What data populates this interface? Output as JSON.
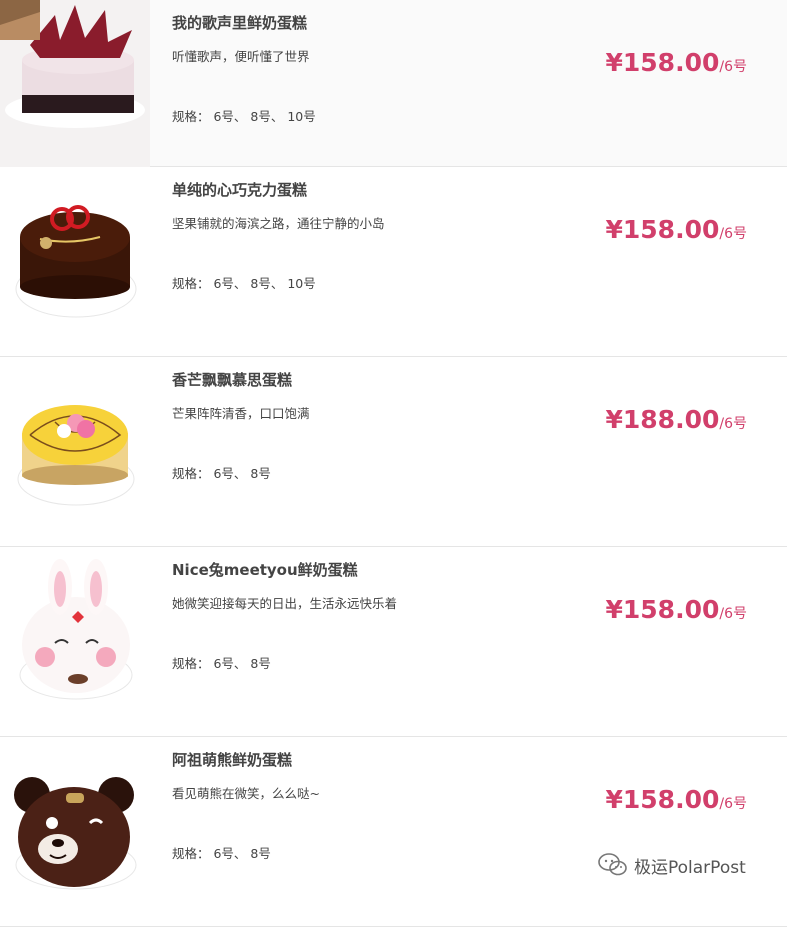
{
  "products": [
    {
      "name": "我的歌声里鲜奶蛋糕",
      "desc": "听懂歌声，便听懂了世界",
      "spec": "规格： 6号、 8号、 10号",
      "price": "¥158.00",
      "unit": "/6号",
      "image": "cake-red-leaves"
    },
    {
      "name": "单纯的心巧克力蛋糕",
      "desc": "坚果铺就的海滨之路，通往宁静的小岛",
      "spec": "规格： 6号、 8号、 10号",
      "price": "¥158.00",
      "unit": "/6号",
      "image": "cake-chocolate-heart"
    },
    {
      "name": "香芒飘飘慕思蛋糕",
      "desc": "芒果阵阵清香，口口饱满",
      "spec": "规格： 6号、 8号",
      "price": "¥188.00",
      "unit": "/6号",
      "image": "cake-mango-mousse"
    },
    {
      "name": "Nice兔meetyou鲜奶蛋糕",
      "desc": "她微笑迎接每天的日出，生活永远快乐着",
      "spec": "规格： 6号、 8号",
      "price": "¥158.00",
      "unit": "/6号",
      "image": "cake-bunny"
    },
    {
      "name": "阿祖萌熊鲜奶蛋糕",
      "desc": "看见萌熊在微笑，么么哒~",
      "spec": "规格： 6号、 8号",
      "price": "¥158.00",
      "unit": "/6号",
      "image": "cake-bear"
    }
  ],
  "watermark": {
    "text": "极运PolarPost",
    "icon": "wechat-icon"
  },
  "colors": {
    "price": "#d13f6b"
  }
}
